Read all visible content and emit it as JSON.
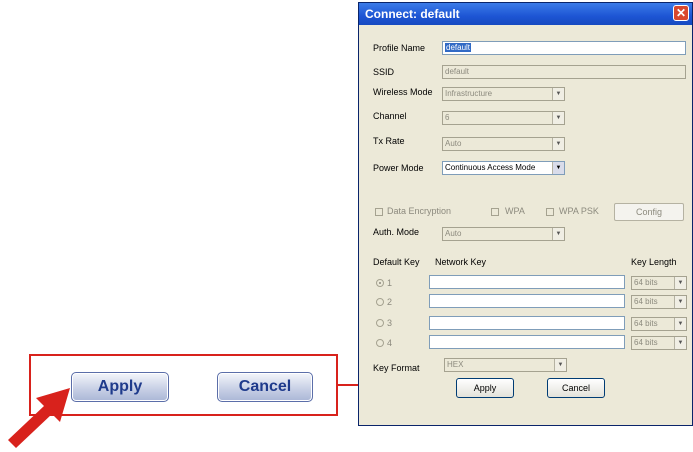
{
  "callout": {
    "apply_label": "Apply",
    "cancel_label": "Cancel"
  },
  "dialog": {
    "title": "Connect: default",
    "profile_name_label": "Profile Name",
    "profile_name_value": "default",
    "ssid_label": "SSID",
    "ssid_value": "default",
    "wireless_mode_label": "Wireless Mode",
    "wireless_mode_value": "Infrastructure",
    "channel_label": "Channel",
    "channel_value": "6",
    "tx_rate_label": "Tx Rate",
    "tx_rate_value": "Auto",
    "power_mode_label": "Power Mode",
    "power_mode_value": "Continuous Access Mode",
    "data_encryption_label": "Data Encryption",
    "wpa_label": "WPA",
    "wpa_psk_label": "WPA PSK",
    "config_label": "Config",
    "auth_mode_label": "Auth. Mode",
    "auth_mode_value": "Auto",
    "default_key_header": "Default Key",
    "network_key_header": "Network Key",
    "key_length_header": "Key Length",
    "keys": [
      {
        "num": "1",
        "length": "64 bits"
      },
      {
        "num": "2",
        "length": "64 bits"
      },
      {
        "num": "3",
        "length": "64 bits"
      },
      {
        "num": "4",
        "length": "64 bits"
      }
    ],
    "key_format_label": "Key Format",
    "key_format_value": "HEX",
    "apply_label": "Apply",
    "cancel_label": "Cancel",
    "close_glyph": "✕"
  },
  "colors": {
    "callout_red": "#d8221c",
    "titlebar_blue": "#1d55d4",
    "dialog_bg": "#ece9d8"
  }
}
